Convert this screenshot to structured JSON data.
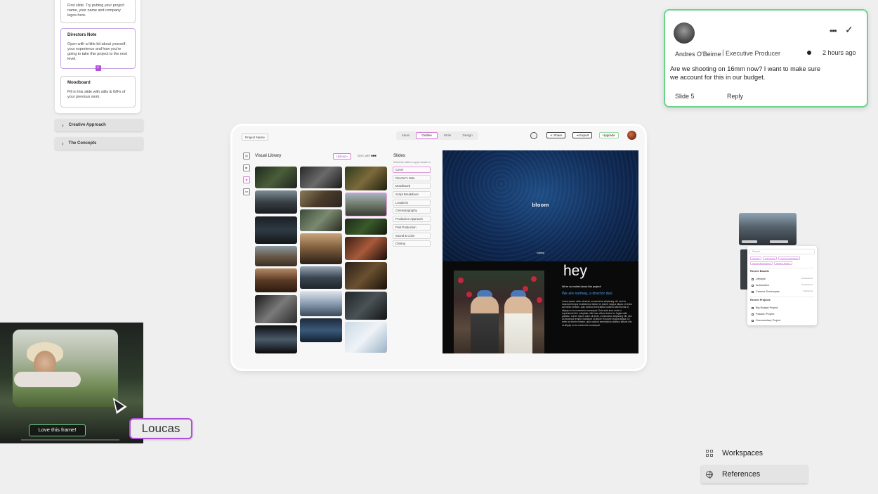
{
  "outline": {
    "cards": [
      {
        "title": "",
        "desc": "First slide. Try putting your project name, your name and company logos here."
      },
      {
        "title": "Directors Note",
        "desc": "Open with a little bit about yourself, your experience and how you're going to take this project to the next level."
      },
      {
        "title": "Moodboard",
        "desc": "Fill in this slide with stills & GIFs of your previous work."
      }
    ],
    "sections": [
      "Creative Approach",
      "The Concepts"
    ]
  },
  "app": {
    "project_name": "Project Name",
    "tabs": [
      "Ideas",
      "Outline",
      "Write",
      "Design"
    ],
    "active_tab": "Outline",
    "share": "Share",
    "export": "Export",
    "upgrade": "Upgrade",
    "visual_library": "Visual Library",
    "upload": "Upload",
    "sync": "Sync with",
    "slides_title": "Slides",
    "slides_sub": "Select the slides to apply visuals to",
    "slides": [
      "Cover",
      "Director's Note",
      "Moodboard",
      "Script Breakdown",
      "Locations",
      "Cinematography",
      "Production Approach",
      "Post Production",
      "Sound & Color",
      "Closing"
    ],
    "hero_title": "bloom",
    "hero_mark": "nutmeg",
    "hey": "hey",
    "hey_line1": "We're so excited about this project!",
    "hey_line2": "We are nutmeg, a director duo.",
    "hey_body": "Lorem ipsum dolor sit amet, consectetur adipiscing elit, sed do eiusmod tempor incididunt ut labore et dolore magna aliqua. Ut enim ad minim veniam, quis nostrud exercitation ullamco laboris nisi ut aliquip ex ea commodo consequat. Duis aute irure dolor in reprehenderit in voluptate velit esse cillum dolore eu fugiat nulla pariatur. Lorem ipsum dolor sit amet, consectetur adipiscing elit, sed do eiusmod tempor incididunt ut labore et dolore magna aliqua. Ut enim ad minim veniam, quis nostrud exercitation ullamco laboris nisi ut aliquip ex ea commodo consequat."
  },
  "comment": {
    "name": "Andres O'Beirne",
    "separator": "|",
    "role": "Executive Producer",
    "time": "2 hours ago",
    "body": "Are we shooting on 16mm now? I want to make sure we account for this in our budget.",
    "slide": "Slide 5",
    "reply": "Reply"
  },
  "search": {
    "placeholder": "Search",
    "tags": [
      "Lifestyle",
      "Automotive",
      "Camera Techniques",
      "City Rooftop Projects",
      "Passion Project"
    ],
    "recent_boards_title": "Recent Boards",
    "boards": [
      {
        "name": "Lifestyle",
        "count": "20 references"
      },
      {
        "name": "Automotive",
        "count": "26 references"
      },
      {
        "name": "Camera Techniques",
        "count": "7 references"
      }
    ],
    "recent_projects_title": "Recent Projects",
    "projects": [
      "Big Budget Project",
      "Passion Project",
      "Documentary Project"
    ]
  },
  "video": {
    "caption": "Love this frame!"
  },
  "collaborator": "Loucas",
  "nav": {
    "workspaces": "Workspaces",
    "references": "References"
  }
}
